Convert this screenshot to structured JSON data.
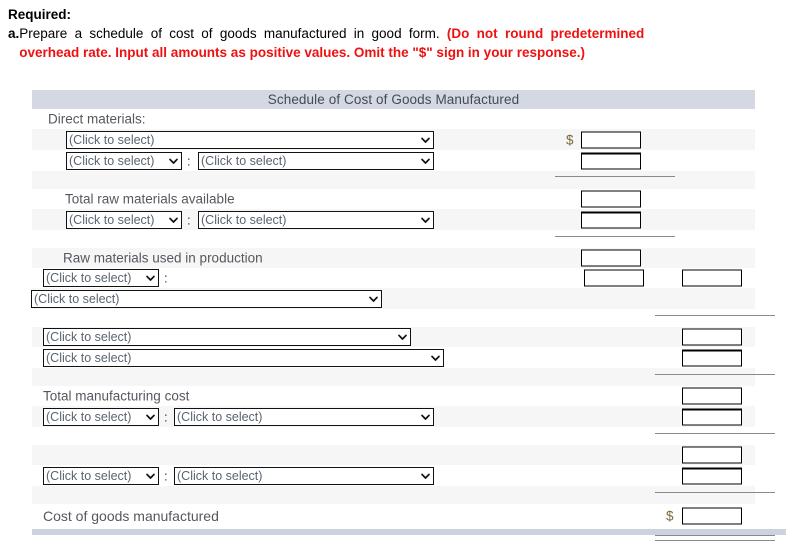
{
  "prompt": {
    "required_label": "Required:",
    "item_letter": "a.",
    "item_text": "Prepare a schedule of cost of goods manufactured in good form. ",
    "item_emphasis": "(Do not round predetermined overhead rate. Input all amounts as positive values. Omit the \"$\" sign in your response.)"
  },
  "schedule": {
    "title": "Schedule of Cost of Goods Manufactured",
    "select_placeholder": "(Click to select)",
    "colon": ":",
    "currency_symbol": "$",
    "labels": {
      "direct_materials": "Direct materials:",
      "total_raw_materials_available": "Total raw materials available",
      "raw_materials_used_in_production": "Raw materials used in production",
      "total_manufacturing_cost": "Total manufacturing cost",
      "cost_of_goods_manufactured": "Cost of goods manufactured"
    }
  },
  "colors": {
    "header_band": "#d4d8e2",
    "alt_row": "#f6f6f6",
    "emphasis_red": "#ee1111",
    "label_text": "#55585e",
    "dollar_sign": "#7a6a3a",
    "foot_bar": "#ccd2e0"
  }
}
